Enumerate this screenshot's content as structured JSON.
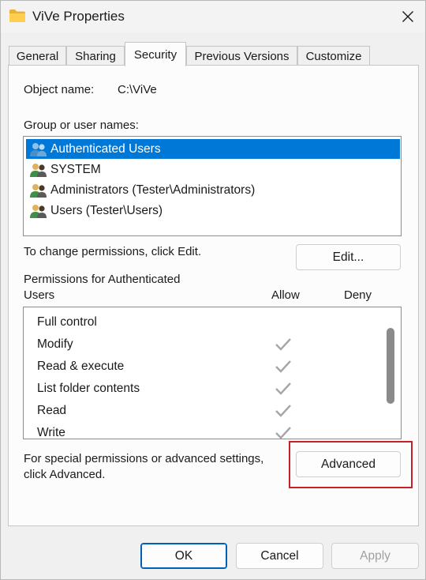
{
  "window": {
    "title": "ViVe Properties",
    "folder_icon": "folder-icon",
    "close_icon": "close-icon"
  },
  "tabs": [
    {
      "label": "General",
      "active": false
    },
    {
      "label": "Sharing",
      "active": false
    },
    {
      "label": "Security",
      "active": true
    },
    {
      "label": "Previous Versions",
      "active": false
    },
    {
      "label": "Customize",
      "active": false
    }
  ],
  "security": {
    "object_name_label": "Object name:",
    "object_name_value": "C:\\ViVe",
    "group_label": "Group or user names:",
    "users": [
      {
        "name": "Authenticated Users",
        "selected": true,
        "icon": "users-group-icon"
      },
      {
        "name": "SYSTEM",
        "selected": false,
        "icon": "users-group-icon"
      },
      {
        "name": "Administrators (Tester\\Administrators)",
        "selected": false,
        "icon": "users-group-icon"
      },
      {
        "name": "Users (Tester\\Users)",
        "selected": false,
        "icon": "users-group-icon"
      }
    ],
    "change_text": "To change permissions, click Edit.",
    "edit_label": "Edit...",
    "permissions_for_line1": "Permissions for Authenticated",
    "permissions_for_line2": "Users",
    "allow_header": "Allow",
    "deny_header": "Deny",
    "permissions": [
      {
        "name": "Full control",
        "allow": false,
        "deny": false
      },
      {
        "name": "Modify",
        "allow": true,
        "deny": false
      },
      {
        "name": "Read & execute",
        "allow": true,
        "deny": false
      },
      {
        "name": "List folder contents",
        "allow": true,
        "deny": false
      },
      {
        "name": "Read",
        "allow": true,
        "deny": false
      },
      {
        "name": "Write",
        "allow": true,
        "deny": false
      }
    ],
    "special_line1": "For special permissions or advanced settings,",
    "special_line2": "click Advanced.",
    "advanced_label": "Advanced"
  },
  "footer": {
    "ok_label": "OK",
    "cancel_label": "Cancel",
    "apply_label": "Apply"
  },
  "colors": {
    "selection": "#0078d7",
    "highlight_box": "#c8202a",
    "check_gray": "#a6a6a6",
    "default_button_border": "#005fb8"
  }
}
